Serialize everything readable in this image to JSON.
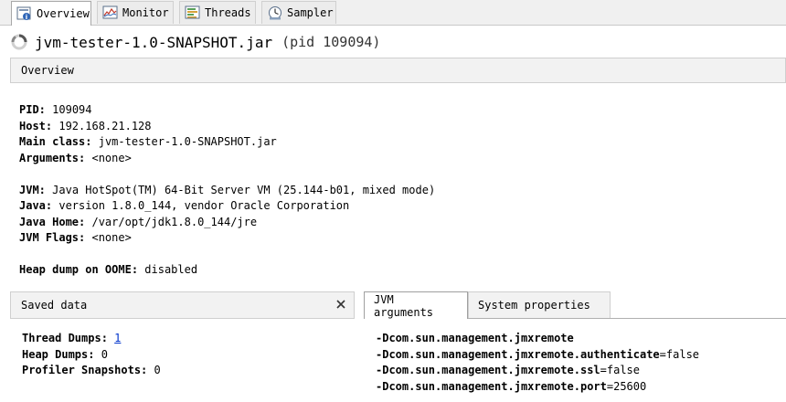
{
  "tabs": [
    {
      "label": "Overview",
      "icon": "overview-icon",
      "active": true
    },
    {
      "label": "Monitor",
      "icon": "monitor-icon",
      "active": false
    },
    {
      "label": "Threads",
      "icon": "threads-icon",
      "active": false
    },
    {
      "label": "Sampler",
      "icon": "sampler-icon",
      "active": false
    }
  ],
  "title": {
    "name": "jvm-tester-1.0-SNAPSHOT.jar",
    "pid": "(pid 109094)"
  },
  "overview_header": "Overview",
  "info": {
    "pid_label": "PID:",
    "pid": "109094",
    "host_label": "Host:",
    "host": "192.168.21.128",
    "main_label": "Main class:",
    "main": "jvm-tester-1.0-SNAPSHOT.jar",
    "args_label": "Arguments:",
    "args": "<none>",
    "jvm_label": "JVM:",
    "jvm": "Java HotSpot(TM) 64-Bit Server VM (25.144-b01, mixed mode)",
    "java_label": "Java:",
    "java": "version 1.8.0_144, vendor Oracle Corporation",
    "home_label": "Java Home:",
    "home": "/var/opt/jdk1.8.0_144/jre",
    "flags_label": "JVM Flags:",
    "flags": "<none>",
    "heap_label": "Heap dump on OOME:",
    "heap": "disabled"
  },
  "saved": {
    "header": "Saved data",
    "thread_label": "Thread Dumps:",
    "thread": "1",
    "heap_label": "Heap Dumps:",
    "heap": "0",
    "prof_label": "Profiler Snapshots:",
    "prof": "0"
  },
  "jvm_tabs": {
    "args": "JVM arguments",
    "sys": "System properties"
  },
  "jvm_args": [
    {
      "key": "-Dcom.sun.management.jmxremote",
      "value": ""
    },
    {
      "key": "-Dcom.sun.management.jmxremote.authenticate",
      "value": "=false"
    },
    {
      "key": "-Dcom.sun.management.jmxremote.ssl",
      "value": "=false"
    },
    {
      "key": "-Dcom.sun.management.jmxremote.port",
      "value": "=25600"
    }
  ]
}
